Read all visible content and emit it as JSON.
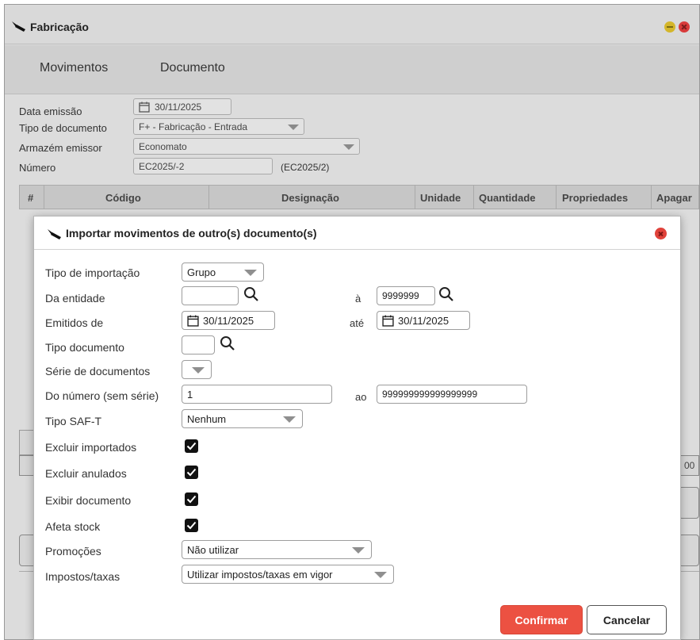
{
  "background_window": {
    "title": "Fabricação",
    "menu": [
      "Movimentos",
      "Documento"
    ],
    "form": {
      "data_emissao_label": "Data emissão",
      "data_emissao_value": "30/11/2025",
      "tipo_documento_label": "Tipo de documento",
      "tipo_documento_value": "F+ - Fabricação - Entrada",
      "armazem_label": "Armazém emissor",
      "armazem_value": "Economato",
      "numero_label": "Número",
      "numero_value": "EC2025/-2",
      "numero_display": "(EC2025/2)"
    },
    "table_headers": [
      "#",
      "Código",
      "Designação",
      "Unidade",
      "Quantidade",
      "Propriedades",
      "Apagar"
    ],
    "fragment_text": "00"
  },
  "dialog": {
    "title": "Importar movimentos de outro(s) documento(s)",
    "fields": {
      "tipo_importacao": {
        "label": "Tipo de importação",
        "value": "Grupo"
      },
      "da_entidade": {
        "label": "Da entidade",
        "value": "",
        "to_label": "à",
        "to_value": "9999999"
      },
      "emitidos_de": {
        "label": "Emitidos de",
        "value": "30/11/2025",
        "to_label": "até",
        "to_value": "30/11/2025"
      },
      "tipo_documento": {
        "label": "Tipo documento",
        "value": ""
      },
      "serie_documentos": {
        "label": "Série de documentos",
        "value": ""
      },
      "do_numero": {
        "label": "Do número (sem série)",
        "value": "1",
        "to_label": "ao",
        "to_value": "999999999999999999"
      },
      "tipo_saft": {
        "label": "Tipo SAF-T",
        "value": "Nenhum"
      },
      "excluir_importados": {
        "label": "Excluir importados",
        "checked": true
      },
      "excluir_anulados": {
        "label": "Excluir anulados",
        "checked": true
      },
      "exibir_documento": {
        "label": "Exibir documento",
        "checked": true
      },
      "afeta_stock": {
        "label": "Afeta stock",
        "checked": true
      },
      "promocoes": {
        "label": "Promoções",
        "value": "Não utilizar"
      },
      "impostos_taxas": {
        "label": "Impostos/taxas",
        "value": "Utilizar impostos/taxas em vigor"
      }
    },
    "buttons": {
      "confirm": "Confirmar",
      "cancel": "Cancelar"
    }
  },
  "colors": {
    "primary": "#ec5142",
    "close": "#e0423b",
    "minimize": "#d4b62a",
    "background": "#dcdcdc"
  },
  "icons": [
    "hammer-icon",
    "calendar-icon",
    "search-icon",
    "checkmark-icon",
    "close-icon",
    "minimize-icon",
    "chevron-down-icon"
  ]
}
